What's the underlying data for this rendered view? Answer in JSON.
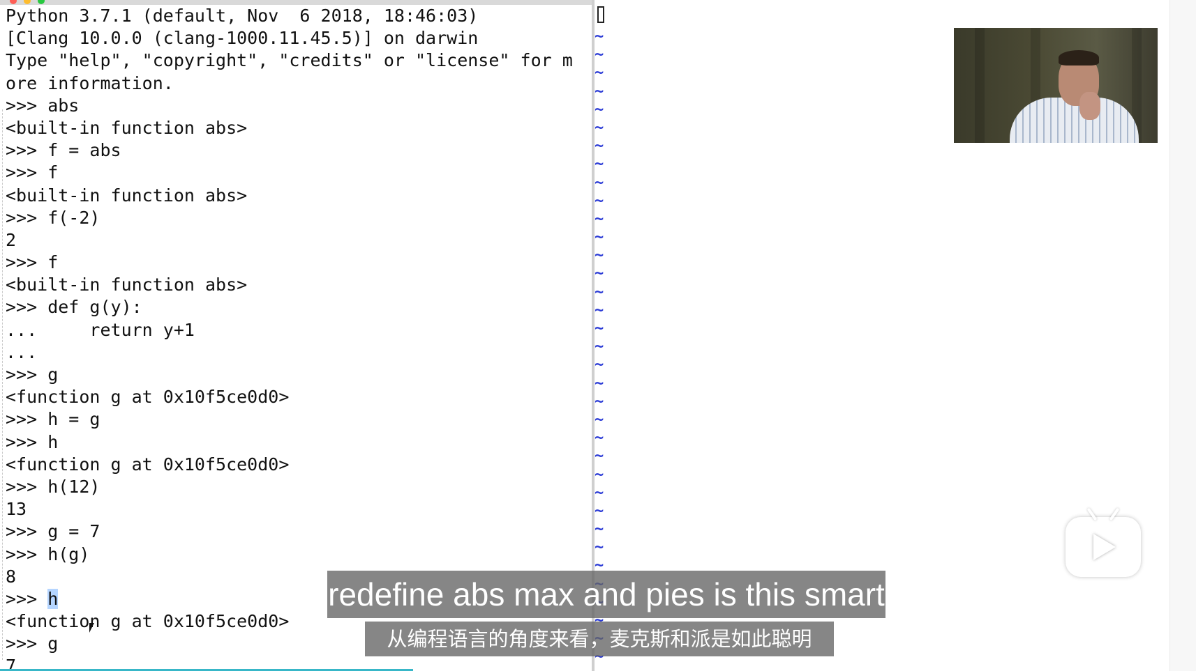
{
  "terminal": {
    "lines": [
      "Python 3.7.1 (default, Nov  6 2018, 18:46:03)",
      "[Clang 10.0.0 (clang-1000.11.45.5)] on darwin",
      "Type \"help\", \"copyright\", \"credits\" or \"license\" for m",
      "ore information.",
      ">>> abs",
      "<built-in function abs>",
      ">>> f = abs",
      ">>> f",
      "<built-in function abs>",
      ">>> f(-2)",
      "2",
      ">>> f",
      "<built-in function abs>",
      ">>> def g(y):",
      "...     return y+1",
      "...",
      ">>> g",
      "<function g at 0x10f5ce0d0>",
      ">>> h = g",
      ">>> h",
      "<function g at 0x10f5ce0d0>",
      ">>> h(12)",
      "13",
      ">>> g = 7",
      ">>> h(g)",
      "8",
      ">>> ",
      "<function g at 0x10f5ce0d0>",
      ">>> g",
      "7"
    ],
    "selected_prompt_text": "h"
  },
  "vim": {
    "tilde": "~",
    "tilde_count": 35
  },
  "subtitles": {
    "english": "redefine abs max and pies is this smart",
    "chinese": "从编程语言的角度来看，麦克斯和派是如此聪明"
  },
  "colors": {
    "tilde": "#2b3bd6",
    "selection": "#b5d5ff",
    "subtitle_bg": "#646464"
  }
}
